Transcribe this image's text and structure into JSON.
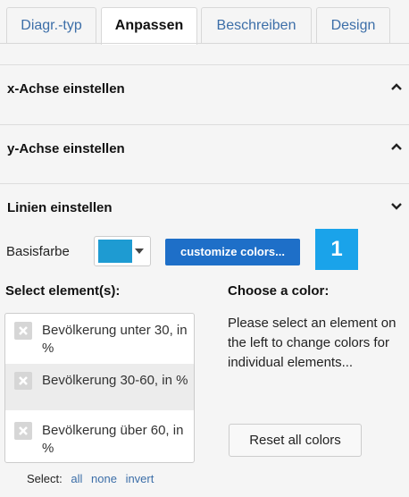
{
  "tabs": [
    {
      "label": "Diagr.-typ",
      "active": false
    },
    {
      "label": "Anpassen",
      "active": true
    },
    {
      "label": "Beschreiben",
      "active": false
    },
    {
      "label": "Design",
      "active": false
    }
  ],
  "sections": [
    {
      "title": "x-Achse einstellen",
      "state": "collapsed",
      "icon": "chevron-up-icon"
    },
    {
      "title": "y-Achse einstellen",
      "state": "collapsed",
      "icon": "chevron-up-icon"
    },
    {
      "title": "Linien einstellen",
      "state": "expanded",
      "icon": "chevron-down-icon"
    }
  ],
  "lines": {
    "base_color_label": "Basisfarbe",
    "base_color": "#1e9bd2",
    "customize_label": "customize colors...",
    "badge": "1",
    "select_heading": "Select element(s):",
    "choose_heading": "Choose a color:",
    "elements": [
      {
        "label": "Bevölkerung unter 30, in %",
        "selected": false
      },
      {
        "label": "Bevölkerung 30-60, in %",
        "selected": true
      },
      {
        "label": "Bevölkerung über 60, in %",
        "selected": false
      }
    ],
    "select_prefix": "Select:",
    "select_all": "all",
    "select_none": "none",
    "select_invert": "invert",
    "help_text": "Please select an element on the left to change colors for individual elements...",
    "reset_label": "Reset all colors"
  },
  "colors": {
    "accent": "#1e6fc8",
    "badge": "#1aa3ea",
    "link": "#3c6ea8"
  }
}
